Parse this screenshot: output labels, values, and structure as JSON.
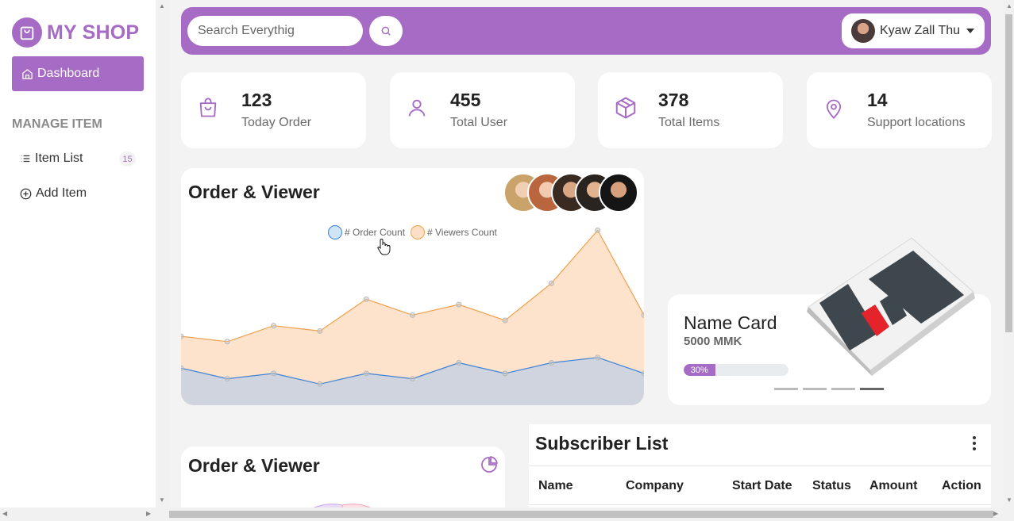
{
  "brand": {
    "name": "MY SHOP",
    "accent": "#a66bc4"
  },
  "sidebar": {
    "dashboard_label": "Dashboard",
    "section_heading": "MANAGE ITEM",
    "items": [
      {
        "label": "Item List",
        "badge": "15",
        "icon": "list-icon"
      },
      {
        "label": "Add Item",
        "icon": "plus-circle-icon"
      }
    ]
  },
  "header": {
    "search_placeholder": "Search Everythig",
    "user_name": "Kyaw Zall Thu"
  },
  "stats": [
    {
      "value": "123",
      "label": "Today Order",
      "icon": "shopping-bag-icon"
    },
    {
      "value": "455",
      "label": "Total User",
      "icon": "user-icon"
    },
    {
      "value": "378",
      "label": "Total Items",
      "icon": "box-icon"
    },
    {
      "value": "14",
      "label": "Support locations",
      "icon": "map-pin-icon"
    }
  ],
  "chart_data": {
    "type": "area",
    "title": "Order & Viewer",
    "series": [
      {
        "name": "# Order Count",
        "color": "#3f82d6",
        "values": [
          7,
          5,
          6,
          4,
          6,
          5,
          8,
          6,
          8,
          9,
          6
        ]
      },
      {
        "name": "# Viewers Count",
        "color": "#f0a04b",
        "values": [
          13,
          12,
          15,
          14,
          20,
          17,
          19,
          16,
          23,
          33,
          17
        ]
      }
    ],
    "ylim": [
      0,
      35
    ],
    "legend": "top-center",
    "grid": false
  },
  "promo": {
    "title": "Name Card",
    "price": "5000 MMK",
    "progress": 30,
    "progress_label": "30%",
    "slides": 4,
    "active_slide": 4
  },
  "chart2": {
    "title": "Order & Viewer"
  },
  "subscribers": {
    "title": "Subscriber List",
    "columns": [
      "Name",
      "Company",
      "Start Date",
      "Status",
      "Amount",
      "Action"
    ]
  }
}
